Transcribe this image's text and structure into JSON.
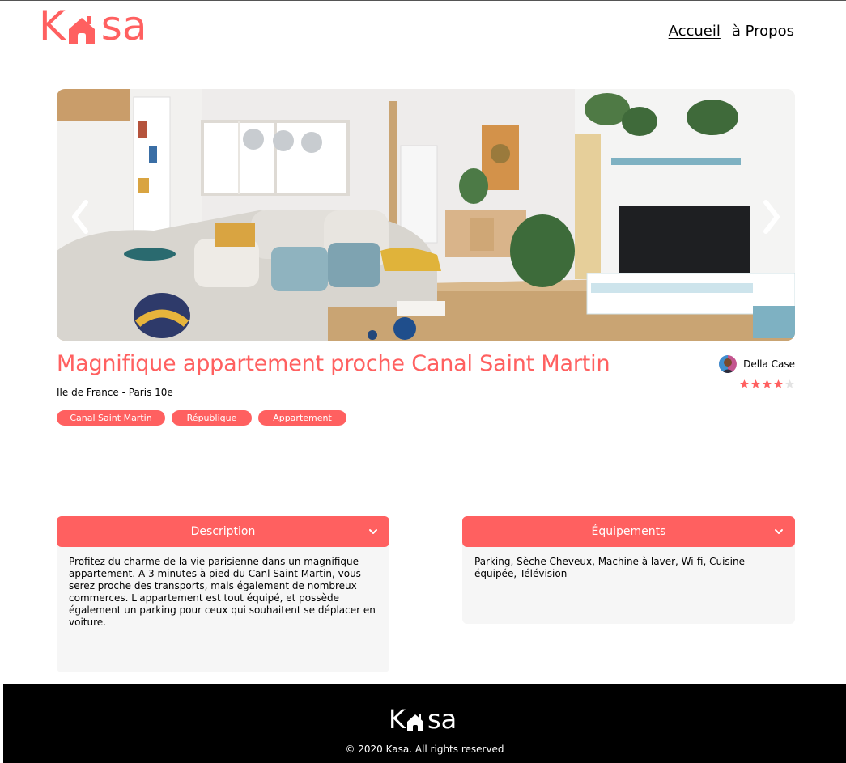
{
  "header": {
    "logo_text": "Kasa",
    "nav": [
      {
        "label": "Accueil",
        "active": true
      },
      {
        "label": "à Propos",
        "active": false
      }
    ]
  },
  "slideshow": {
    "prev_icon": "chevron-left-icon",
    "next_icon": "chevron-right-icon",
    "image_alt": ""
  },
  "listing": {
    "title": "Magnifique appartement proche Canal Saint Martin",
    "location": "Ile de France - Paris 10e",
    "tags": [
      "Canal Saint Martin",
      "République",
      "Appartement"
    ],
    "host_name": "Della Case",
    "rating": 4,
    "rating_max": 5
  },
  "collapses": {
    "description": {
      "title": "Description",
      "body": "Profitez du charme de la vie parisienne dans un magnifique appartement. A 3 minutes à pied du Canl Saint Martin, vous serez proche des transports, mais également de nombreux commerces. L'appartement est tout équipé, et possède également un parking pour ceux qui souhaitent se déplacer en voiture."
    },
    "equipments": {
      "title": "Équipements",
      "body": "Parking, Sèche Cheveux, Machine à laver, Wi-fi, Cuisine équipée, Télévision"
    }
  },
  "footer": {
    "logo_text": "Kasa",
    "copyright": "© 2020 Kasa. All rights reserved"
  },
  "colors": {
    "accent": "#FF6060",
    "panel_bg": "#F6F6F6",
    "footer_bg": "#000000",
    "star_off": "#E3E3E3"
  }
}
